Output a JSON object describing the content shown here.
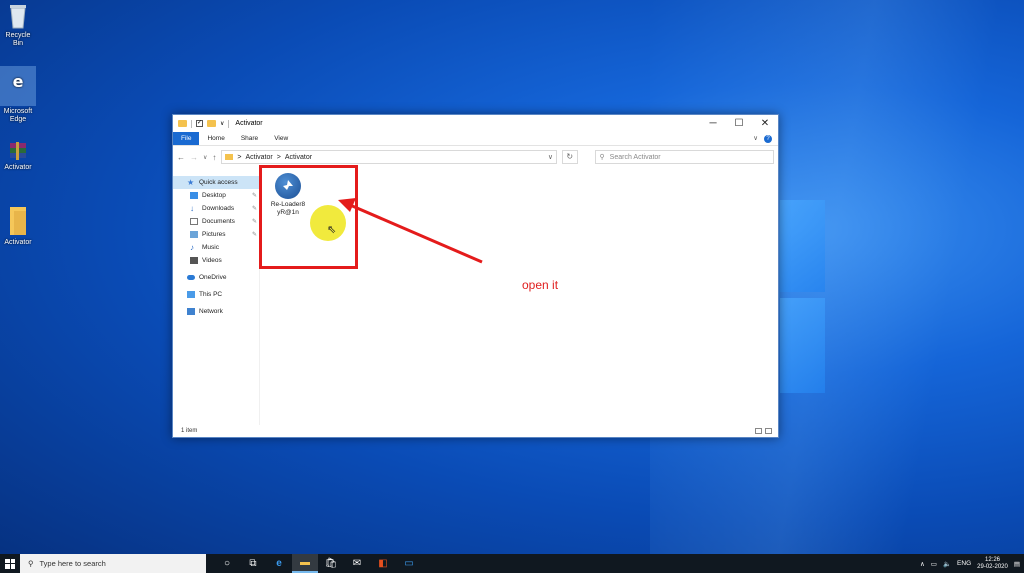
{
  "desktop": {
    "icons": [
      {
        "label": "Recycle Bin",
        "icon": "recycle-bin-icon"
      },
      {
        "label": "Microsoft Edge",
        "icon": "edge-icon"
      },
      {
        "label": "Activator",
        "icon": "winrar-archive-icon"
      },
      {
        "label": "Activator",
        "icon": "folder-icon"
      }
    ]
  },
  "window": {
    "title": "Activator",
    "ribbon": {
      "file": "File",
      "home": "Home",
      "share": "Share",
      "view": "View"
    },
    "controls": {
      "minimize": "─",
      "maximize": "☐",
      "close": "✕"
    },
    "address": {
      "root": "Activator",
      "current": "Activator",
      "separator": ">"
    },
    "search_placeholder": "Search Activator",
    "nav": [
      {
        "label": "Quick access",
        "icon": "star-icon",
        "active": true
      },
      {
        "label": "Desktop",
        "icon": "desktop-icon",
        "pinned": true
      },
      {
        "label": "Downloads",
        "icon": "download-icon",
        "pinned": true
      },
      {
        "label": "Documents",
        "icon": "documents-icon",
        "pinned": true
      },
      {
        "label": "Pictures",
        "icon": "pictures-icon",
        "pinned": true
      },
      {
        "label": "Music",
        "icon": "music-icon"
      },
      {
        "label": "Videos",
        "icon": "videos-icon"
      },
      {
        "label": "OneDrive",
        "icon": "onedrive-icon"
      },
      {
        "label": "This PC",
        "icon": "pc-icon"
      },
      {
        "label": "Network",
        "icon": "network-icon"
      }
    ],
    "files": [
      {
        "name_line1": "Re-Loader8",
        "name_line2": "yR@1n",
        "icon": "reloader-app-icon"
      }
    ],
    "status": "1 item"
  },
  "annotation": {
    "text": "open it",
    "color": "#e41b1b"
  },
  "taskbar": {
    "search_placeholder": "Type here to search",
    "apps": [
      "cortana-icon",
      "task-view-icon",
      "edge-icon",
      "file-explorer-icon",
      "store-icon",
      "mail-icon",
      "office-icon",
      "photos-icon"
    ],
    "tray": {
      "lang": "ENG",
      "time": "12:26",
      "date": "29-02-2020"
    }
  }
}
